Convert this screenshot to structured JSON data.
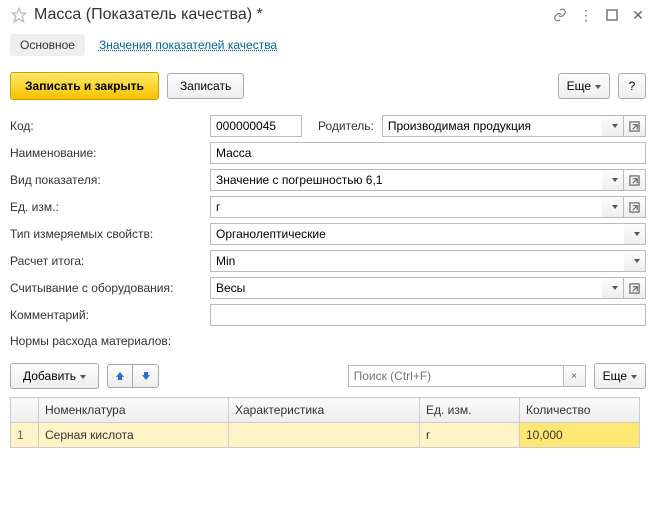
{
  "header": {
    "title": "Масса (Показатель качества) *"
  },
  "tabs": {
    "main": "Основное",
    "values_link": "Значения показателей качества"
  },
  "toolbar": {
    "save_close": "Записать и закрыть",
    "save": "Записать",
    "more": "Еще",
    "help": "?"
  },
  "labels": {
    "code": "Код:",
    "parent": "Родитель:",
    "name": "Наименование:",
    "type": "Вид показателя:",
    "uom": "Ед. изм.:",
    "measured_type": "Тип измеряемых свойств:",
    "calc": "Расчет итога:",
    "device_read": "Считывание с оборудования:",
    "comment": "Комментарий:",
    "materials": "Нормы расхода материалов:"
  },
  "fields": {
    "code": "000000045",
    "parent": "Производимая продукция",
    "name": "Масса",
    "type": "Значение с погрешностью 6,1",
    "uom": "г",
    "measured_type": "Органолептические",
    "calc": "Min",
    "device_read": "Весы",
    "comment": ""
  },
  "materials": {
    "add": "Добавить",
    "search_placeholder": "Поиск (Ctrl+F)",
    "more": "Еще",
    "columns": {
      "num": "",
      "nomen": "Номенклатура",
      "char": "Характеристика",
      "uom": "Ед. изм.",
      "qty": "Количество"
    },
    "rows": [
      {
        "num": "1",
        "nomen": "Серная кислота",
        "char": "",
        "uom": "г",
        "qty": "10,000"
      }
    ]
  }
}
